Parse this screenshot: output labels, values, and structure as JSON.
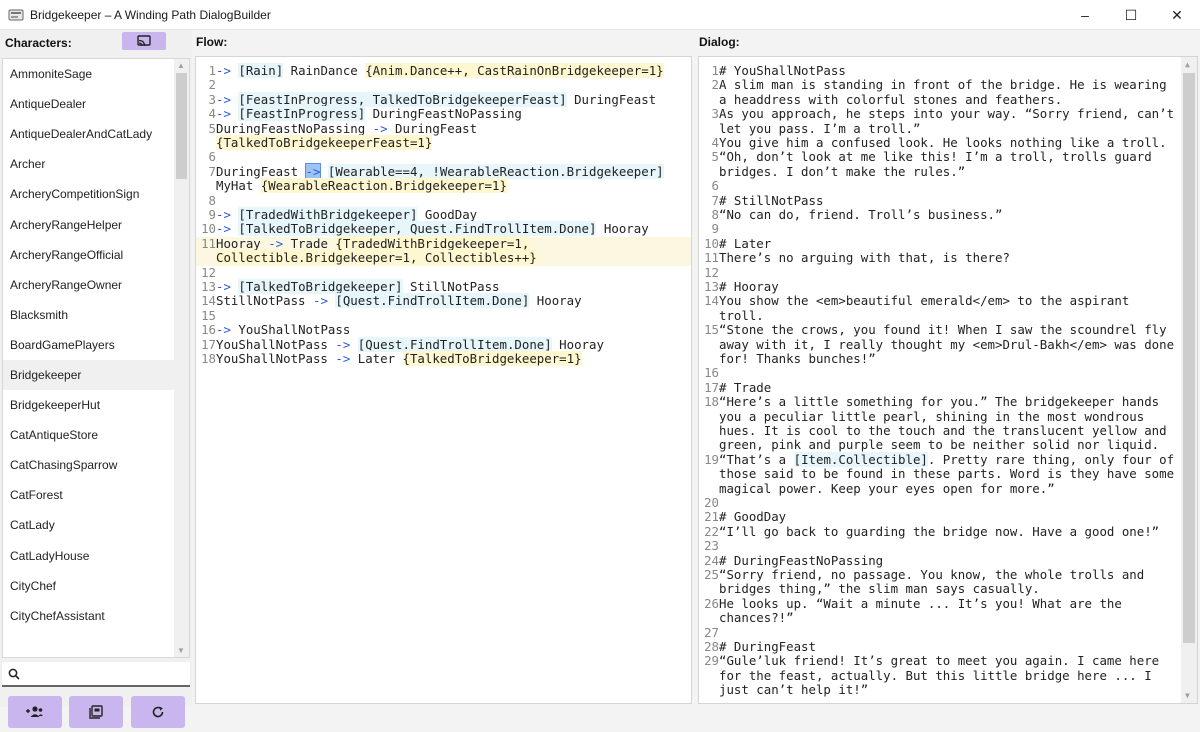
{
  "window": {
    "title": "Bridgekeeper – A Winding Path DialogBuilder",
    "minimize": "–",
    "maximize": "☐",
    "close": "✕"
  },
  "left": {
    "label": "Characters:",
    "items": [
      "AmmoniteSage",
      "AntiqueDealer",
      "AntiqueDealerAndCatLady",
      "Archer",
      "ArcheryCompetitionSign",
      "ArcheryRangeHelper",
      "ArcheryRangeOfficial",
      "ArcheryRangeOwner",
      "Blacksmith",
      "BoardGamePlayers",
      "Bridgekeeper",
      "BridgekeeperHut",
      "CatAntiqueStore",
      "CatChasingSparrow",
      "CatForest",
      "CatLady",
      "CatLadyHouse",
      "CityChef",
      "CityChefAssistant"
    ],
    "selected_index": 10,
    "search": {
      "value": "",
      "placeholder": ""
    }
  },
  "flow": {
    "label": "Flow:",
    "lines": [
      {
        "n": "1",
        "segs": [
          {
            "t": "-> ",
            "c": "arrow"
          },
          {
            "t": "[Rain]",
            "c": "cond"
          },
          {
            "t": " RainDance "
          },
          {
            "t": "{Anim.Dance++, CastRainOnBridgekeeper=1}",
            "c": "act"
          }
        ]
      },
      {
        "n": "2",
        "segs": []
      },
      {
        "n": "3",
        "segs": [
          {
            "t": "-> ",
            "c": "arrow"
          },
          {
            "t": "[FeastInProgress, TalkedToBridgekeeperFeast]",
            "c": "cond"
          },
          {
            "t": " DuringFeast"
          }
        ]
      },
      {
        "n": "4",
        "segs": [
          {
            "t": "-> ",
            "c": "arrow"
          },
          {
            "t": "[FeastInProgress]",
            "c": "cond"
          },
          {
            "t": " DuringFeastNoPassing"
          }
        ]
      },
      {
        "n": "5",
        "segs": [
          {
            "t": "DuringFeastNoPassing "
          },
          {
            "t": "->",
            "c": "arrow"
          },
          {
            "t": " DuringFeast"
          }
        ]
      },
      {
        "n": "",
        "segs": [
          {
            "t": "{TalkedToBridgekeeperFeast=1}",
            "c": "act"
          }
        ]
      },
      {
        "n": "6",
        "segs": []
      },
      {
        "n": "7",
        "segs": [
          {
            "t": "DuringFeast "
          },
          {
            "t": "->",
            "c": "sel"
          },
          {
            "t": " "
          },
          {
            "t": "[Wearable==4, !WearableReaction.Bridgekeeper]",
            "c": "cond"
          }
        ]
      },
      {
        "n": "",
        "segs": [
          {
            "t": "MyHat "
          },
          {
            "t": "{WearableReaction.Bridgekeeper=1}",
            "c": "act"
          }
        ]
      },
      {
        "n": "8",
        "segs": []
      },
      {
        "n": "9",
        "segs": [
          {
            "t": "-> ",
            "c": "arrow"
          },
          {
            "t": "[TradedWithBridgekeeper]",
            "c": "cond"
          },
          {
            "t": " GoodDay"
          }
        ]
      },
      {
        "n": "10",
        "segs": [
          {
            "t": "-> ",
            "c": "arrow"
          },
          {
            "t": "[TalkedToBridgekeeper, Quest.FindTrollItem.Done]",
            "c": "cond"
          },
          {
            "t": " Hooray"
          }
        ]
      },
      {
        "n": "11",
        "hl": true,
        "segs": [
          {
            "t": "Hooray "
          },
          {
            "t": "->",
            "c": "arrow"
          },
          {
            "t": " Trade "
          },
          {
            "t": "{TradedWithBridgekeeper=1,",
            "c": "act"
          }
        ]
      },
      {
        "n": "",
        "hl": true,
        "segs": [
          {
            "t": "Collectible.Bridgekeeper=1, Collectibles++}",
            "c": "act"
          }
        ]
      },
      {
        "n": "12",
        "segs": []
      },
      {
        "n": "13",
        "segs": [
          {
            "t": "-> ",
            "c": "arrow"
          },
          {
            "t": "[TalkedToBridgekeeper]",
            "c": "cond"
          },
          {
            "t": " StillNotPass"
          }
        ]
      },
      {
        "n": "14",
        "segs": [
          {
            "t": "StillNotPass "
          },
          {
            "t": "->",
            "c": "arrow"
          },
          {
            "t": " "
          },
          {
            "t": "[Quest.FindTrollItem.Done]",
            "c": "cond"
          },
          {
            "t": " Hooray"
          }
        ]
      },
      {
        "n": "15",
        "segs": []
      },
      {
        "n": "16",
        "segs": [
          {
            "t": "-> ",
            "c": "arrow"
          },
          {
            "t": "YouShallNotPass"
          }
        ]
      },
      {
        "n": "17",
        "segs": [
          {
            "t": "YouShallNotPass "
          },
          {
            "t": "->",
            "c": "arrow"
          },
          {
            "t": " "
          },
          {
            "t": "[Quest.FindTrollItem.Done]",
            "c": "cond"
          },
          {
            "t": " Hooray"
          }
        ]
      },
      {
        "n": "18",
        "segs": [
          {
            "t": "YouShallNotPass "
          },
          {
            "t": "->",
            "c": "arrow"
          },
          {
            "t": " Later "
          },
          {
            "t": "{TalkedToBridgekeeper=1}",
            "c": "act"
          }
        ]
      }
    ]
  },
  "dialog": {
    "label": "Dialog:",
    "lines": [
      {
        "n": "1",
        "segs": [
          {
            "t": "# YouShallNotPass"
          }
        ]
      },
      {
        "n": "2",
        "segs": [
          {
            "t": "A slim man is standing in front of the bridge. He is wearing"
          }
        ]
      },
      {
        "n": "",
        "segs": [
          {
            "t": "a headdress with colorful stones and feathers."
          }
        ]
      },
      {
        "n": "3",
        "segs": [
          {
            "t": "As you approach, he steps into your way. “Sorry friend, can’t"
          }
        ]
      },
      {
        "n": "",
        "segs": [
          {
            "t": "let you pass. I’m a troll.”"
          }
        ]
      },
      {
        "n": "4",
        "segs": [
          {
            "t": "You give him a confused look. He looks nothing like a troll."
          }
        ]
      },
      {
        "n": "5",
        "segs": [
          {
            "t": "“Oh, don’t look at me like this! I’m a troll, trolls guard"
          }
        ]
      },
      {
        "n": "",
        "segs": [
          {
            "t": "bridges. I don’t make the rules.”"
          }
        ]
      },
      {
        "n": "6",
        "segs": []
      },
      {
        "n": "7",
        "segs": [
          {
            "t": "# StillNotPass"
          }
        ]
      },
      {
        "n": "8",
        "segs": [
          {
            "t": "“No can do, friend. Troll’s business.”"
          }
        ]
      },
      {
        "n": "9",
        "segs": []
      },
      {
        "n": "10",
        "segs": [
          {
            "t": "# Later"
          }
        ]
      },
      {
        "n": "11",
        "segs": [
          {
            "t": "There’s no arguing with that, is there?"
          }
        ]
      },
      {
        "n": "12",
        "segs": []
      },
      {
        "n": "13",
        "segs": [
          {
            "t": "# Hooray"
          }
        ]
      },
      {
        "n": "14",
        "segs": [
          {
            "t": "You show the <em>beautiful emerald</em> to the aspirant"
          }
        ]
      },
      {
        "n": "",
        "segs": [
          {
            "t": "troll."
          }
        ]
      },
      {
        "n": "15",
        "segs": [
          {
            "t": "“Stone the crows, you found it! When I saw the scoundrel fly"
          }
        ]
      },
      {
        "n": "",
        "segs": [
          {
            "t": "away with it, I really thought my <em>Drul-Bakh</em> was done"
          }
        ]
      },
      {
        "n": "",
        "segs": [
          {
            "t": "for! Thanks bunches!”"
          }
        ]
      },
      {
        "n": "16",
        "segs": []
      },
      {
        "n": "17",
        "segs": [
          {
            "t": "# Trade"
          }
        ]
      },
      {
        "n": "18",
        "segs": [
          {
            "t": "“Here’s a little something for you.” The bridgekeeper hands"
          }
        ]
      },
      {
        "n": "",
        "segs": [
          {
            "t": "you a peculiar little pearl, shining in the most wondrous"
          }
        ]
      },
      {
        "n": "",
        "segs": [
          {
            "t": "hues. It is cool to the touch and the translucent yellow and"
          }
        ]
      },
      {
        "n": "",
        "segs": [
          {
            "t": "green, pink and purple seem to be neither solid nor liquid."
          }
        ]
      },
      {
        "n": "19",
        "segs": [
          {
            "t": "“That’s a "
          },
          {
            "t": "[Item.Collectible]",
            "c": "cond"
          },
          {
            "t": ". Pretty rare thing, only four of"
          }
        ]
      },
      {
        "n": "",
        "segs": [
          {
            "t": "those said to be found in these parts. Word is they have some"
          }
        ]
      },
      {
        "n": "",
        "segs": [
          {
            "t": "magical power. Keep your eyes open for more.”"
          }
        ]
      },
      {
        "n": "20",
        "segs": []
      },
      {
        "n": "21",
        "segs": [
          {
            "t": "# GoodDay"
          }
        ]
      },
      {
        "n": "22",
        "segs": [
          {
            "t": "“I’ll go back to guarding the bridge now. Have a good one!”"
          }
        ]
      },
      {
        "n": "23",
        "segs": []
      },
      {
        "n": "24",
        "segs": [
          {
            "t": "# DuringFeastNoPassing"
          }
        ]
      },
      {
        "n": "25",
        "segs": [
          {
            "t": "“Sorry friend, no passage. You know, the whole trolls and"
          }
        ]
      },
      {
        "n": "",
        "segs": [
          {
            "t": "bridges thing,” the slim man says casually."
          }
        ]
      },
      {
        "n": "26",
        "segs": [
          {
            "t": "He looks up. “Wait a minute ... It’s you! What are the"
          }
        ]
      },
      {
        "n": "",
        "segs": [
          {
            "t": "chances?!”"
          }
        ]
      },
      {
        "n": "27",
        "segs": []
      },
      {
        "n": "28",
        "segs": [
          {
            "t": "# DuringFeast"
          }
        ]
      },
      {
        "n": "29",
        "segs": [
          {
            "t": "“Gule’luk friend! It’s great to meet you again. I came here"
          }
        ]
      },
      {
        "n": "",
        "segs": [
          {
            "t": "for the feast, actually. But this little bridge here ... I"
          }
        ]
      },
      {
        "n": "",
        "segs": [
          {
            "t": "just can’t help it!”"
          }
        ]
      }
    ]
  },
  "colors": {
    "accent_button": "#c9b6ee",
    "arrow": "#2a5bd7",
    "condition_bg": "#e6f6fb",
    "action_bg": "#fff7cf"
  }
}
